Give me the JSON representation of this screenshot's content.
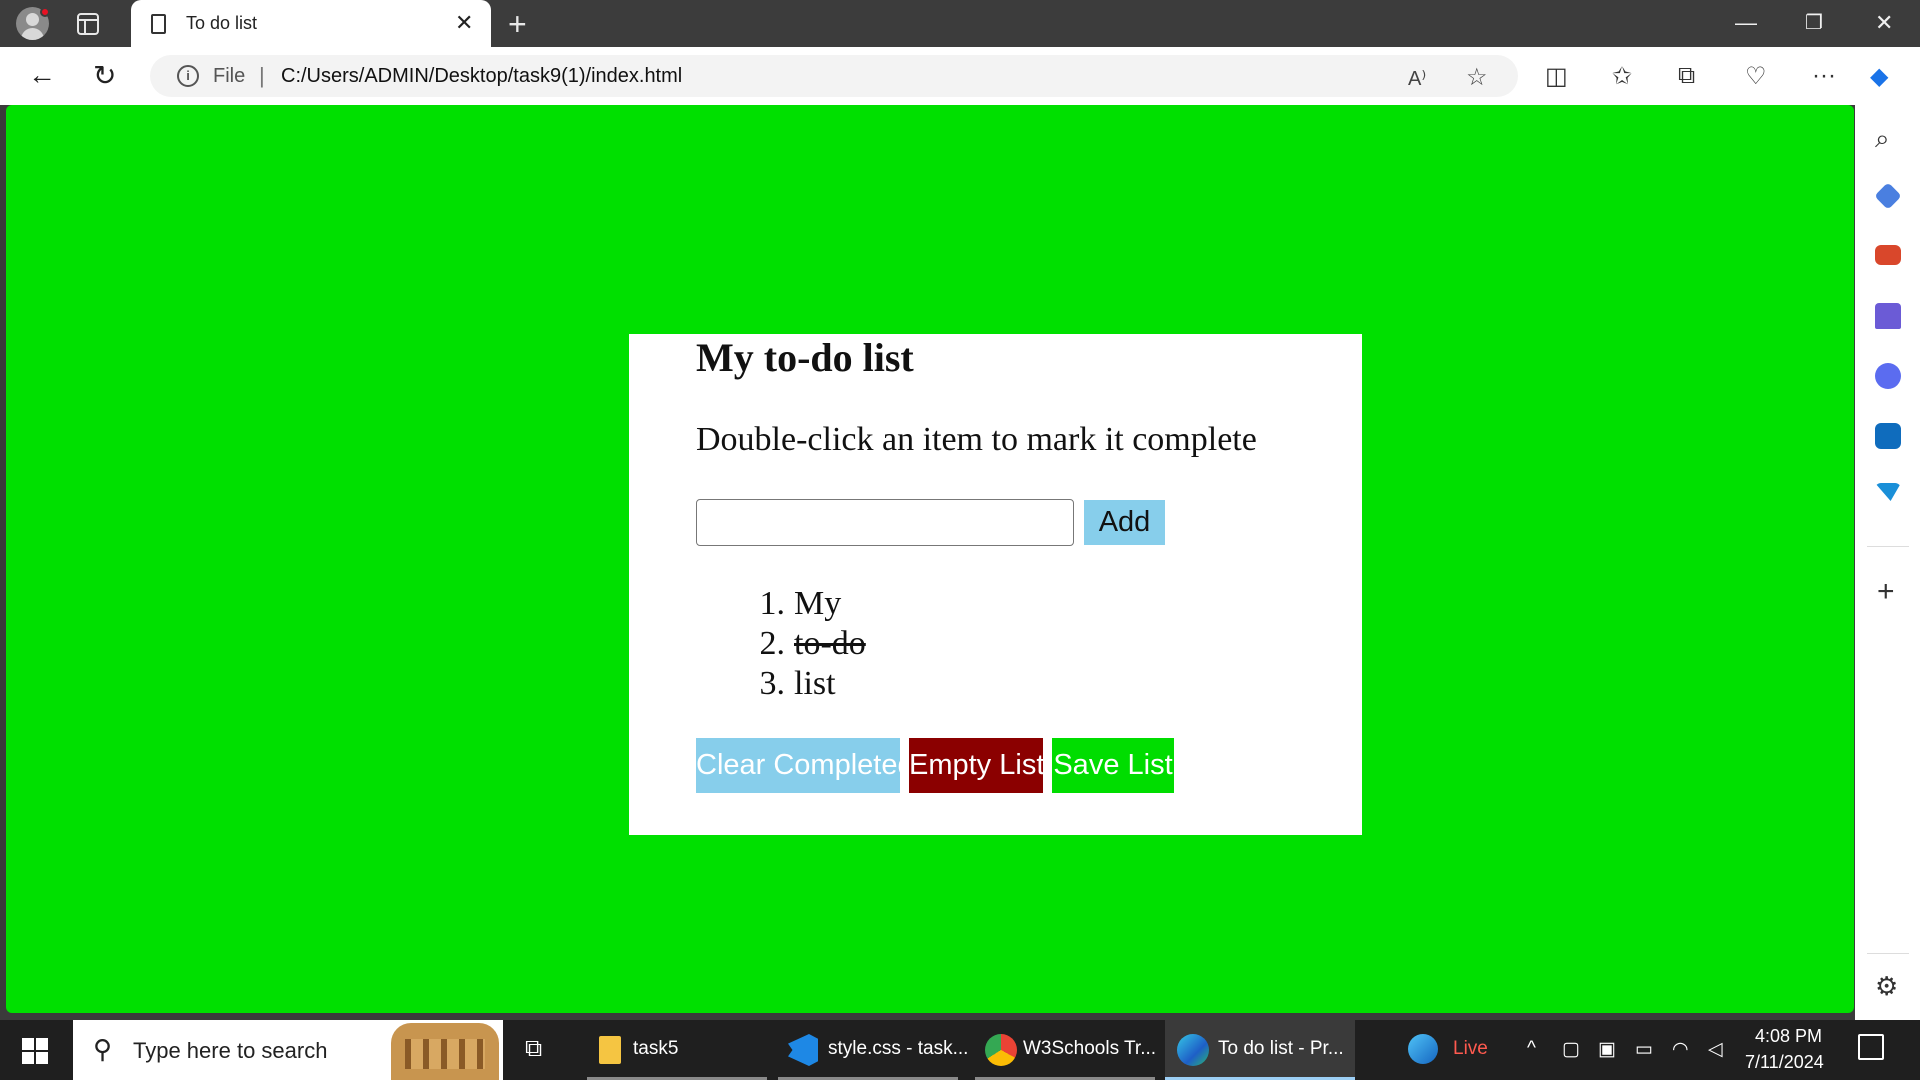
{
  "browser": {
    "tab_title": "To do list",
    "url_scheme_label": "File",
    "url": "C:/Users/ADMIN/Desktop/task9(1)/index.html"
  },
  "page": {
    "background_color": "#00e000",
    "heading": "My to-do list",
    "instructions": "Double-click an item to mark it complete",
    "input_value": "",
    "add_label": "Add",
    "items": [
      {
        "number": "1.",
        "text": "My",
        "completed": false
      },
      {
        "number": "2.",
        "text": "to-do",
        "completed": true
      },
      {
        "number": "3.",
        "text": "list",
        "completed": false
      }
    ],
    "buttons": {
      "clear_completed": "Clear Completed",
      "empty_list": "Empty List",
      "save_list": "Save List"
    },
    "colors": {
      "add": "#87ceeb",
      "clear_completed": "#87ceeb",
      "empty_list": "#8b0000",
      "save_list": "#00dd00"
    }
  },
  "taskbar": {
    "search_placeholder": "Type here to search",
    "apps": [
      {
        "label": "task5",
        "icon": "folder-icon"
      },
      {
        "label": "style.css - task...",
        "icon": "vscode-icon"
      },
      {
        "label": "W3Schools Tr...",
        "icon": "chrome-icon"
      },
      {
        "label": "To do list - Pr...",
        "icon": "edge-icon"
      }
    ],
    "live_label": "Live",
    "time": "4:08 PM",
    "date": "7/11/2024"
  }
}
